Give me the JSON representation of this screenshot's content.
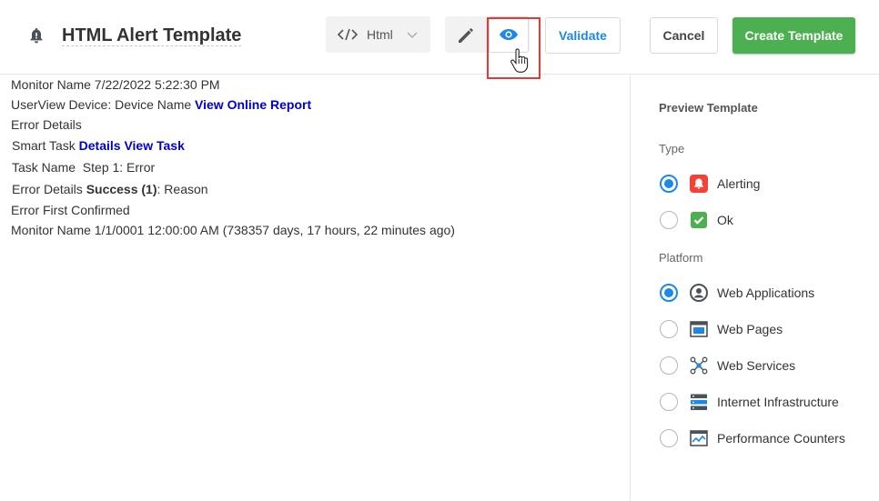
{
  "header": {
    "title": "HTML Alert Template",
    "format_select": {
      "value": "Html"
    },
    "buttons": {
      "validate": "Validate",
      "cancel": "Cancel",
      "create": "Create Template"
    }
  },
  "preview_lines": [
    {
      "text": "Monitor Name 7/22/2022 5:22:30 PM",
      "link": ""
    },
    {
      "text": "UserView Device: Device Name ",
      "link": "View Online Report"
    },
    {
      "text": "Error Details",
      "link": ""
    },
    {
      "text": "Smart Task ",
      "link": "Details View Task"
    },
    {
      "text": "Task Name  Step 1: Error",
      "link": ""
    },
    {
      "text": "Error Details ",
      "bold": "Success (1)",
      "after": ": Reason"
    },
    {
      "text": "Error First Confirmed",
      "link": ""
    },
    {
      "text": "Monitor Name 1/1/0001 12:00:00 AM (738357 days, 17 hours, 22 minutes ago)",
      "link": ""
    }
  ],
  "panel": {
    "title": "Preview Template",
    "type_label": "Type",
    "type_options": [
      {
        "label": "Alerting",
        "selected": true,
        "icon": "alert-bell-icon",
        "color": "#f44336"
      },
      {
        "label": "Ok",
        "selected": false,
        "icon": "check-icon",
        "color": "#4caf50"
      }
    ],
    "platform_label": "Platform",
    "platform_options": [
      {
        "label": "Web Applications",
        "selected": true,
        "icon": "user-circle-icon"
      },
      {
        "label": "Web Pages",
        "selected": false,
        "icon": "browser-window-icon"
      },
      {
        "label": "Web Services",
        "selected": false,
        "icon": "network-nodes-icon"
      },
      {
        "label": "Internet Infrastructure",
        "selected": false,
        "icon": "server-stack-icon"
      },
      {
        "label": "Performance Counters",
        "selected": false,
        "icon": "chart-monitor-icon"
      }
    ]
  },
  "colors": {
    "accent": "#1e88e5",
    "create": "#4caf50",
    "link": "#0000cc",
    "highlight": "#e53935"
  }
}
